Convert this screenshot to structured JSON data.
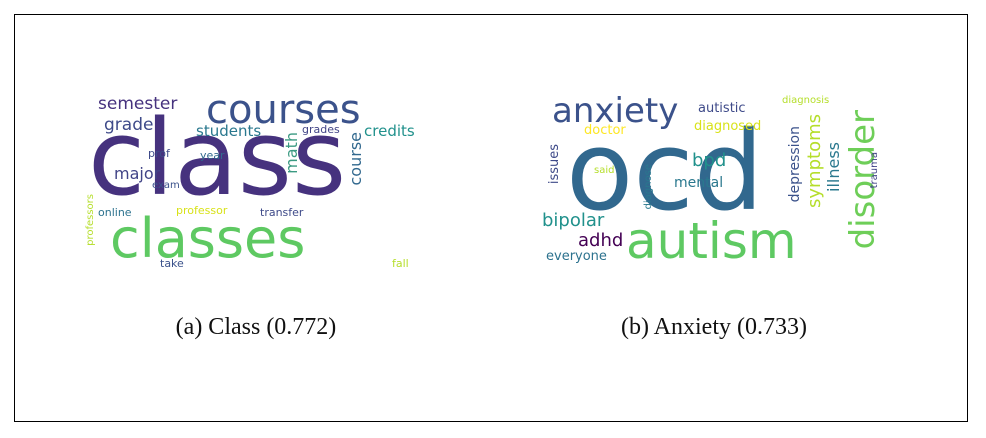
{
  "figure": {
    "caption_a": "(a) Class (0.772)",
    "caption_b": "(b) Anxiety (0.733)"
  },
  "cloud_a": {
    "words": [
      {
        "text": "class",
        "color": "#46327e"
      },
      {
        "text": "classes",
        "color": "#5ec962"
      },
      {
        "text": "courses",
        "color": "#3b528b"
      },
      {
        "text": "semester",
        "color": "#46327e"
      },
      {
        "text": "grade",
        "color": "#3e4a89"
      },
      {
        "text": "students",
        "color": "#2a788e"
      },
      {
        "text": "math",
        "color": "#3b9a82"
      },
      {
        "text": "grades",
        "color": "#414487"
      },
      {
        "text": "course",
        "color": "#31688e"
      },
      {
        "text": "credits",
        "color": "#21918c"
      },
      {
        "text": "prof",
        "color": "#3e4a89"
      },
      {
        "text": "year",
        "color": "#31688e"
      },
      {
        "text": "major",
        "color": "#414487"
      },
      {
        "text": "exam",
        "color": "#3b528b"
      },
      {
        "text": "online",
        "color": "#2c728e"
      },
      {
        "text": "professor",
        "color": "#d8e219"
      },
      {
        "text": "transfer",
        "color": "#3e4a89"
      },
      {
        "text": "professors",
        "color": "#b5de2b"
      },
      {
        "text": "take",
        "color": "#3b528b"
      },
      {
        "text": "fall",
        "color": "#b5de2b"
      }
    ]
  },
  "cloud_b": {
    "words": [
      {
        "text": "ocd",
        "color": "#31688e"
      },
      {
        "text": "autism",
        "color": "#5ec962"
      },
      {
        "text": "anxiety",
        "color": "#3b528b"
      },
      {
        "text": "autistic",
        "color": "#3e4a89"
      },
      {
        "text": "diagnosis",
        "color": "#b5de2b"
      },
      {
        "text": "diagnosed",
        "color": "#d8e219"
      },
      {
        "text": "doctor",
        "color": "#fde725"
      },
      {
        "text": "disorder",
        "color": "#6ece58"
      },
      {
        "text": "symptoms",
        "color": "#b5de2b"
      },
      {
        "text": "illness",
        "color": "#2a788e"
      },
      {
        "text": "trauma",
        "color": "#414487"
      },
      {
        "text": "depression",
        "color": "#3b528b"
      },
      {
        "text": "issues",
        "color": "#3e4a89"
      },
      {
        "text": "said",
        "color": "#b5de2b"
      },
      {
        "text": "diagnose",
        "color": "#2a788e"
      },
      {
        "text": "bpd",
        "color": "#21918c"
      },
      {
        "text": "mental",
        "color": "#2a788e"
      },
      {
        "text": "bipolar",
        "color": "#21918c"
      },
      {
        "text": "adhd",
        "color": "#440154"
      },
      {
        "text": "everyone",
        "color": "#2c728e"
      }
    ]
  }
}
